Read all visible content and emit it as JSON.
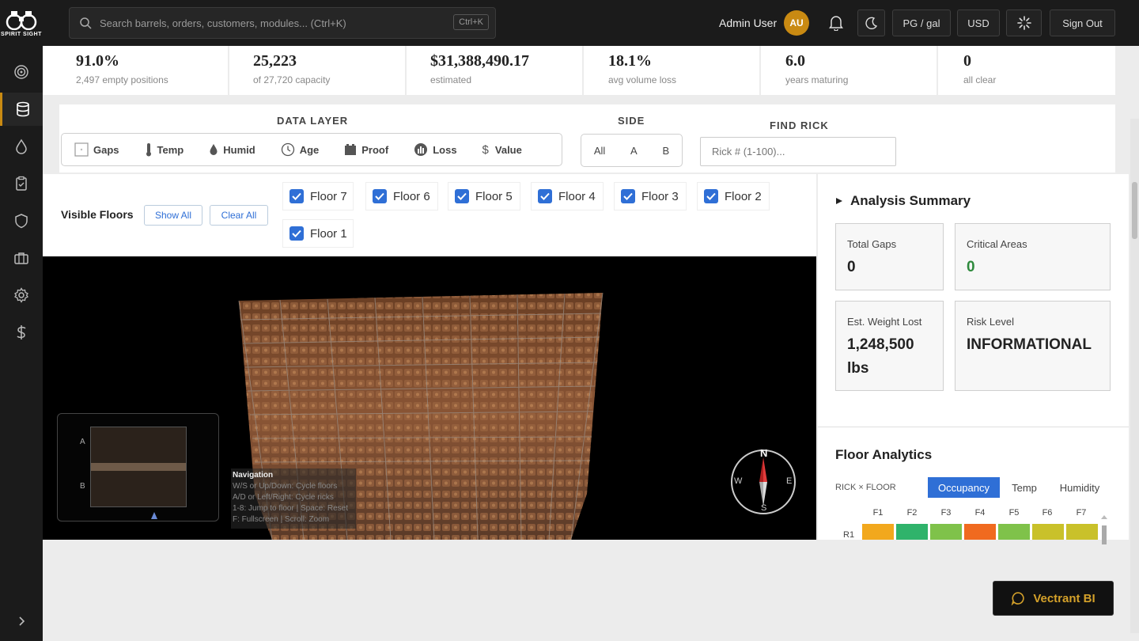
{
  "app": {
    "logo_text": "SPIRIT SIGHT",
    "search": {
      "placeholder": "Search barrels, orders, customers, modules... (Ctrl+K)",
      "shortcut": "Ctrl+K"
    },
    "user": {
      "name": "Admin User",
      "initials": "AU"
    },
    "units_label": "PG / gal",
    "currency_label": "USD",
    "sign_out_label": "Sign Out"
  },
  "sidebar": {
    "items": [
      {
        "icon": "target-icon"
      },
      {
        "icon": "database-icon",
        "active": true
      },
      {
        "icon": "droplet-icon"
      },
      {
        "icon": "clipboard-icon"
      },
      {
        "icon": "shield-icon"
      },
      {
        "icon": "briefcase-icon"
      },
      {
        "icon": "gear-icon"
      },
      {
        "icon": "dollar-icon"
      }
    ],
    "expand_icon": "chevron-right-icon"
  },
  "stats": [
    {
      "value": "91.0%",
      "sub": "2,497 empty positions"
    },
    {
      "value": "25,223",
      "sub": "of 27,720 capacity"
    },
    {
      "value": "$31,388,490.17",
      "sub": "estimated"
    },
    {
      "value": "18.1%",
      "sub": "avg volume loss"
    },
    {
      "value": "6.0",
      "sub": "years maturing"
    },
    {
      "value": "0",
      "sub": "all clear"
    }
  ],
  "controls": {
    "data_layer_label": "DATA LAYER",
    "layers": [
      "Gaps",
      "Temp",
      "Humid",
      "Age",
      "Proof",
      "Loss",
      "Value"
    ],
    "side_label": "SIDE",
    "sides": [
      "All",
      "A",
      "B"
    ],
    "find_rick_label": "FIND RICK",
    "find_rick_placeholder": "Rick # (1-100)..."
  },
  "floors": {
    "label": "Visible Floors",
    "show_all": "Show All",
    "clear_all": "Clear All",
    "items": [
      "Floor 7",
      "Floor 6",
      "Floor 5",
      "Floor 4",
      "Floor 3",
      "Floor 2",
      "Floor 1"
    ]
  },
  "viewport": {
    "minimap_labels": [
      "A",
      "B"
    ],
    "nav_title": "Navigation",
    "nav_lines": [
      "W/S or Up/Down: Cycle floors",
      "A/D or Left/Right: Cycle ricks",
      "1-8: Jump to floor | Space: Reset",
      "F: Fullscreen | Scroll: Zoom"
    ],
    "compass": {
      "n": "N",
      "e": "E",
      "s": "S",
      "w": "W"
    }
  },
  "analysis": {
    "title": "Analysis Summary",
    "total_gaps_label": "Total Gaps",
    "total_gaps_value": "0",
    "critical_label": "Critical Areas",
    "critical_value": "0",
    "weight_label": "Est. Weight Lost",
    "weight_value": "1,248,500",
    "weight_unit": "lbs",
    "risk_label": "Risk Level",
    "risk_value": "INFORMATIONAL"
  },
  "floor_analytics": {
    "title": "Floor Analytics",
    "axis_label": "RICK × FLOOR",
    "tabs": [
      "Occupancy",
      "Temp",
      "Humidity"
    ],
    "columns": [
      "F1",
      "F2",
      "F3",
      "F4",
      "F5",
      "F6",
      "F7"
    ],
    "row_label": "R1",
    "row_colors": [
      "#f2a81d",
      "#2fb36b",
      "#7fc24a",
      "#f06a1f",
      "#7fc24a",
      "#c9c12a",
      "#c9c12a"
    ]
  },
  "assistant": {
    "label": "Vectrant BI"
  },
  "colors": {
    "accent": "#c98a12",
    "primary_blue": "#2f6fd6",
    "critical_green": "#2e8a3d"
  }
}
